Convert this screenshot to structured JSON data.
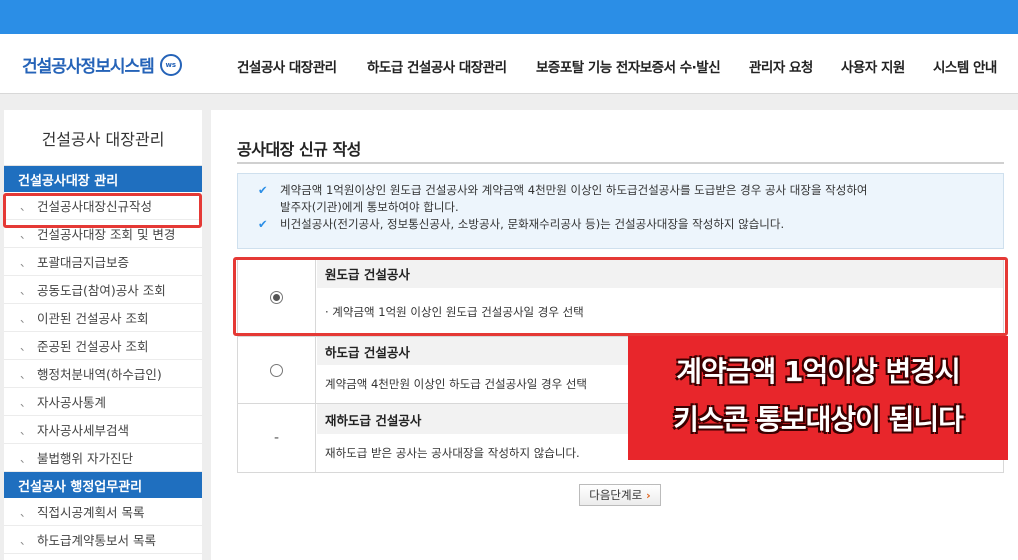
{
  "header": {
    "logo_text": "건설공사정보시스템",
    "logo_badge": "ws",
    "nav": [
      "건설공사 대장관리",
      "하도급 건설공사 대장관리",
      "보증포탈 기능 전자보증서 수·발신",
      "관리자 요청",
      "사용자 지원",
      "시스템 안내"
    ]
  },
  "sidebar": {
    "title": "건설공사 대장관리",
    "section1": "건설공사대장 관리",
    "items1": [
      "건설공사대장신규작성",
      "건설공사대장 조회 및 변경",
      "포괄대금지급보증",
      "공동도급(참여)공사 조회",
      "이관된 건설공사 조회",
      "준공된 건설공사 조회",
      "행정처분내역(하수급인)",
      "자사공사통계",
      "자사공사세부검색",
      "불법행위 자가진단"
    ],
    "section2": "건설공사 행정업무관리",
    "items2": [
      "직접시공계획서 목록",
      "하도급계약통보서 목록"
    ],
    "item_mark": "、"
  },
  "main": {
    "title": "공사대장 신규 작성",
    "notice": {
      "check": "✔",
      "line1a": "계약금액 1억원이상인 원도급 건설공사와 계약금액 4천만원 이상인 하도급건설공사를 도급받은 경우 공사 대장을 작성하여",
      "line1b": "발주자(기관)에게 통보하여야 합니다.",
      "line2": "비건설공사(전기공사, 정보통신공사, 소방공사, 문화재수리공사 등)는 건설공사대장을 작성하지 않습니다."
    },
    "options": [
      {
        "name": "원도급 건설공사",
        "desc": "· 계약금액 1억원 이상인 원도급 건설공사일 경우 선택",
        "selected": true
      },
      {
        "name": "하도급 건설공사",
        "desc": "계약금액 4천만원 이상인 하도급 건설공사일 경우 선택",
        "selected": false
      },
      {
        "name": "재하도급 건설공사",
        "desc": "재하도급 받은 공사는 공사대장을 작성하지 않습니다.",
        "marker": "-"
      }
    ],
    "next_button": "다음단계로",
    "next_arrow": "›"
  },
  "callout": {
    "line1": "계약금액 1억이상 변경시",
    "line2": "키스콘 통보대상이 됩니다"
  },
  "colors": {
    "topbar": "#2b8ee6",
    "sidebar_section": "#1f6fbf",
    "highlight": "#e53935",
    "callout": "#e8262b"
  }
}
